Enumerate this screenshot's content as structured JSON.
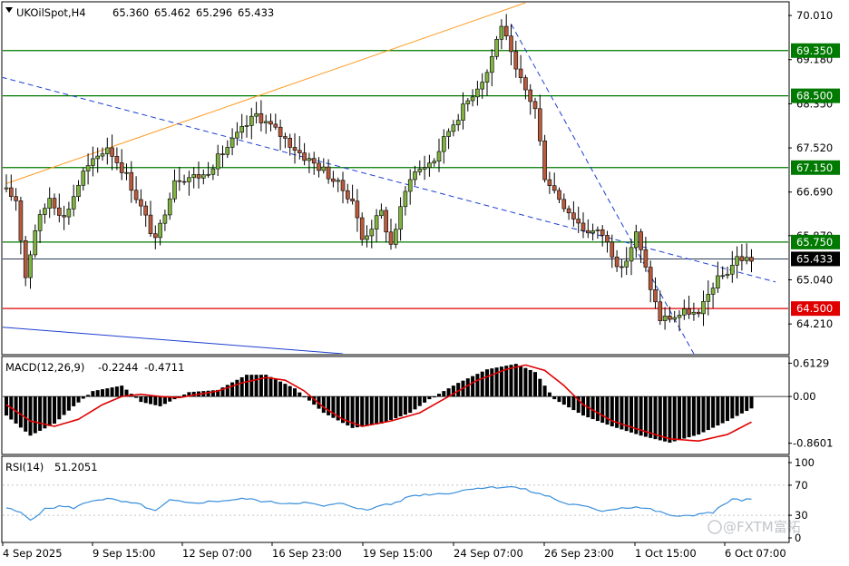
{
  "header": {
    "symbol": "UKOilSpot,H4",
    "open": "65.360",
    "high": "65.462",
    "low": "65.296",
    "close": "65.433"
  },
  "watermark": "@FXTM富拓",
  "colors": {
    "bull": "#7fb241",
    "bear": "#b85a3c",
    "wick": "#000000",
    "hline_green": "#007a00",
    "hline_red": "#e00000",
    "trend_orange": "#ff9a1f",
    "trend_blue_dash": "#1c3fd1",
    "trend_blue_solid": "#1c3fd1",
    "price_line": "#2c3a57",
    "macd_hist": "#000000",
    "macd_signal": "#e00000",
    "rsi": "#3a8fdc"
  },
  "chart_data": [
    {
      "type": "candlestick",
      "title": "UKOilSpot,H4",
      "y_ticks": [
        "70.010",
        "69.180",
        "68.350",
        "67.520",
        "66.690",
        "65.870",
        "65.040",
        "64.210"
      ],
      "ylim": [
        63.65,
        70.25
      ],
      "x_labels": [
        "4 Sep 2025",
        "9 Sep 15:00",
        "12 Sep 07:00",
        "16 Sep 23:00",
        "19 Sep 15:00",
        "24 Sep 07:00",
        "26 Sep 23:00",
        "1 Oct 15:00",
        "6 Oct 07:00"
      ],
      "horizontal_levels": [
        {
          "value": 69.35,
          "label": "69.350",
          "kind": "green"
        },
        {
          "value": 68.5,
          "label": "68.500",
          "kind": "green"
        },
        {
          "value": 67.15,
          "label": "67.150",
          "kind": "green"
        },
        {
          "value": 65.75,
          "label": "65.750",
          "kind": "green"
        },
        {
          "value": 64.5,
          "label": "64.500",
          "kind": "red"
        }
      ],
      "current_price": {
        "value": 65.433,
        "label": "65.433"
      },
      "anchors": [
        [
          0,
          66.7
        ],
        [
          2,
          66.55
        ],
        [
          4,
          65.1
        ],
        [
          6,
          66.0
        ],
        [
          9,
          66.6
        ],
        [
          12,
          66.2
        ],
        [
          16,
          67.05
        ],
        [
          21,
          67.55
        ],
        [
          25,
          67.0
        ],
        [
          29,
          66.2
        ],
        [
          31,
          65.75
        ],
        [
          35,
          66.95
        ],
        [
          41,
          67.0
        ],
        [
          48,
          67.75
        ],
        [
          52,
          68.15
        ],
        [
          56,
          67.85
        ],
        [
          62,
          67.35
        ],
        [
          66,
          67.1
        ],
        [
          72,
          66.55
        ],
        [
          74,
          65.8
        ],
        [
          78,
          66.3
        ],
        [
          80,
          65.7
        ],
        [
          84,
          67.0
        ],
        [
          89,
          67.3
        ],
        [
          92,
          67.85
        ],
        [
          97,
          68.55
        ],
        [
          100,
          68.95
        ],
        [
          103,
          69.85
        ],
        [
          106,
          68.95
        ],
        [
          110,
          68.25
        ],
        [
          112,
          67.0
        ],
        [
          116,
          66.45
        ],
        [
          120,
          66.0
        ],
        [
          124,
          65.9
        ],
        [
          128,
          65.2
        ],
        [
          131,
          65.9
        ],
        [
          134,
          64.9
        ],
        [
          136,
          64.3
        ],
        [
          139,
          64.35
        ],
        [
          142,
          64.45
        ],
        [
          144,
          64.35
        ],
        [
          147,
          64.95
        ],
        [
          150,
          65.2
        ],
        [
          152,
          65.45
        ],
        [
          155,
          65.43
        ]
      ],
      "trendlines": [
        {
          "kind": "orange",
          "points": [
            [
              0,
              66.85
            ],
            [
              108,
              70.25
            ]
          ]
        },
        {
          "kind": "blue_dash",
          "points": [
            [
              -1,
              68.85
            ],
            [
              160,
              65.0
            ]
          ]
        },
        {
          "kind": "blue_dash",
          "points": [
            [
              105,
              69.85
            ],
            [
              143,
              63.65
            ]
          ]
        },
        {
          "kind": "blue_solid",
          "points": [
            [
              -1,
              64.15
            ],
            [
              70,
              63.65
            ]
          ]
        }
      ]
    },
    {
      "type": "bar",
      "title": "MACD(12,26,9)",
      "labels": {
        "name": "MACD(12,26,9)",
        "macd": "-0.2244",
        "signal": "-0.4711"
      },
      "y_ticks": [
        "0.6129",
        "0.00",
        "-0.8601"
      ],
      "ylim": [
        -1.05,
        0.72
      ],
      "macd_anchors": [
        [
          0,
          -0.35
        ],
        [
          5,
          -0.72
        ],
        [
          10,
          -0.5
        ],
        [
          14,
          -0.18
        ],
        [
          18,
          0.1
        ],
        [
          24,
          0.2
        ],
        [
          28,
          -0.1
        ],
        [
          32,
          -0.18
        ],
        [
          38,
          0.08
        ],
        [
          44,
          0.12
        ],
        [
          50,
          0.4
        ],
        [
          54,
          0.4
        ],
        [
          60,
          0.15
        ],
        [
          66,
          -0.3
        ],
        [
          72,
          -0.58
        ],
        [
          78,
          -0.5
        ],
        [
          84,
          -0.3
        ],
        [
          88,
          -0.05
        ],
        [
          94,
          0.25
        ],
        [
          100,
          0.5
        ],
        [
          106,
          0.6
        ],
        [
          110,
          0.45
        ],
        [
          114,
          -0.05
        ],
        [
          120,
          -0.35
        ],
        [
          126,
          -0.55
        ],
        [
          132,
          -0.72
        ],
        [
          138,
          -0.85
        ],
        [
          144,
          -0.7
        ],
        [
          150,
          -0.45
        ],
        [
          155,
          -0.22
        ]
      ],
      "signal_anchors": [
        [
          0,
          -0.15
        ],
        [
          5,
          -0.45
        ],
        [
          10,
          -0.55
        ],
        [
          15,
          -0.42
        ],
        [
          20,
          -0.15
        ],
        [
          24,
          0.0
        ],
        [
          28,
          0.04
        ],
        [
          32,
          0.0
        ],
        [
          36,
          -0.02
        ],
        [
          40,
          0.04
        ],
        [
          44,
          0.1
        ],
        [
          49,
          0.25
        ],
        [
          54,
          0.35
        ],
        [
          58,
          0.3
        ],
        [
          62,
          0.1
        ],
        [
          66,
          -0.2
        ],
        [
          70,
          -0.42
        ],
        [
          74,
          -0.55
        ],
        [
          80,
          -0.45
        ],
        [
          86,
          -0.3
        ],
        [
          92,
          0.0
        ],
        [
          98,
          0.3
        ],
        [
          104,
          0.5
        ],
        [
          108,
          0.58
        ],
        [
          112,
          0.48
        ],
        [
          116,
          0.2
        ],
        [
          120,
          -0.15
        ],
        [
          126,
          -0.45
        ],
        [
          132,
          -0.62
        ],
        [
          138,
          -0.78
        ],
        [
          144,
          -0.82
        ],
        [
          150,
          -0.7
        ],
        [
          155,
          -0.47
        ]
      ]
    },
    {
      "type": "line",
      "title": "RSI(14)",
      "labels": {
        "name": "RSI(14)",
        "value": "51.2051"
      },
      "y_ticks": [
        "100",
        "70",
        "30",
        "0"
      ],
      "ylim": [
        0,
        100
      ],
      "levels": [
        70,
        30
      ],
      "anchors": [
        [
          0,
          40
        ],
        [
          3,
          33
        ],
        [
          5,
          24
        ],
        [
          8,
          38
        ],
        [
          11,
          42
        ],
        [
          14,
          40
        ],
        [
          18,
          50
        ],
        [
          21,
          52
        ],
        [
          25,
          47
        ],
        [
          28,
          44
        ],
        [
          31,
          35
        ],
        [
          34,
          50
        ],
        [
          38,
          46
        ],
        [
          42,
          48
        ],
        [
          46,
          50
        ],
        [
          50,
          52
        ],
        [
          54,
          48
        ],
        [
          58,
          46
        ],
        [
          62,
          47
        ],
        [
          66,
          42
        ],
        [
          70,
          46
        ],
        [
          73,
          40
        ],
        [
          75,
          36
        ],
        [
          78,
          44
        ],
        [
          81,
          46
        ],
        [
          84,
          56
        ],
        [
          88,
          58
        ],
        [
          93,
          60
        ],
        [
          97,
          66
        ],
        [
          101,
          67
        ],
        [
          105,
          68
        ],
        [
          108,
          64
        ],
        [
          111,
          58
        ],
        [
          113,
          55
        ],
        [
          116,
          46
        ],
        [
          120,
          42
        ],
        [
          124,
          36
        ],
        [
          128,
          40
        ],
        [
          131,
          41
        ],
        [
          134,
          38
        ],
        [
          137,
          32
        ],
        [
          140,
          28
        ],
        [
          143,
          30
        ],
        [
          145,
          34
        ],
        [
          147,
          33
        ],
        [
          149,
          44
        ],
        [
          151,
          51
        ],
        [
          153,
          50
        ],
        [
          155,
          51.2
        ]
      ]
    }
  ]
}
